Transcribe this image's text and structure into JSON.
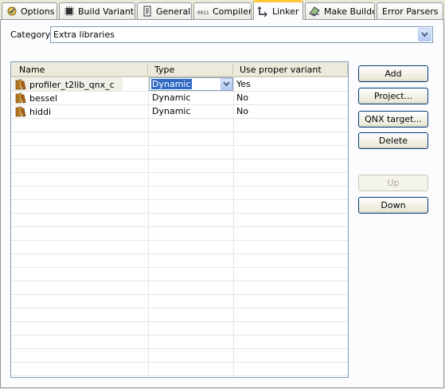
{
  "tabs": [
    {
      "label": "Options",
      "icon": "options-icon"
    },
    {
      "label": "Build Variants",
      "icon": "chip-icon"
    },
    {
      "label": "General",
      "icon": "document-icon"
    },
    {
      "label": "Compiler",
      "icon": "binary-icon"
    },
    {
      "label": "Linker",
      "icon": "linker-icon",
      "active": true
    },
    {
      "label": "Make Builder",
      "icon": "make-builder-icon"
    },
    {
      "label": "Error Parsers",
      "icon": ""
    }
  ],
  "category": {
    "label": "Category",
    "value": "Extra libraries"
  },
  "table": {
    "columns": [
      "Name",
      "Type",
      "Use proper variant"
    ],
    "rows": [
      {
        "name": "profiler_t2lib_qnx_c",
        "type": "Dynamic",
        "variant": "Yes"
      },
      {
        "name": "bessel",
        "type": "Dynamic",
        "variant": "No"
      },
      {
        "name": "hiddi",
        "type": "Dynamic",
        "variant": "No"
      }
    ]
  },
  "buttons": {
    "add": "Add",
    "project": "Project...",
    "qnx_target": "QNX target...",
    "delete": "Delete",
    "up": "Up",
    "down": "Down"
  },
  "colors": {
    "panel_bg": "#ece9d8",
    "active_tab_highlight": "#ffc73c",
    "selection": "#316ac5"
  }
}
